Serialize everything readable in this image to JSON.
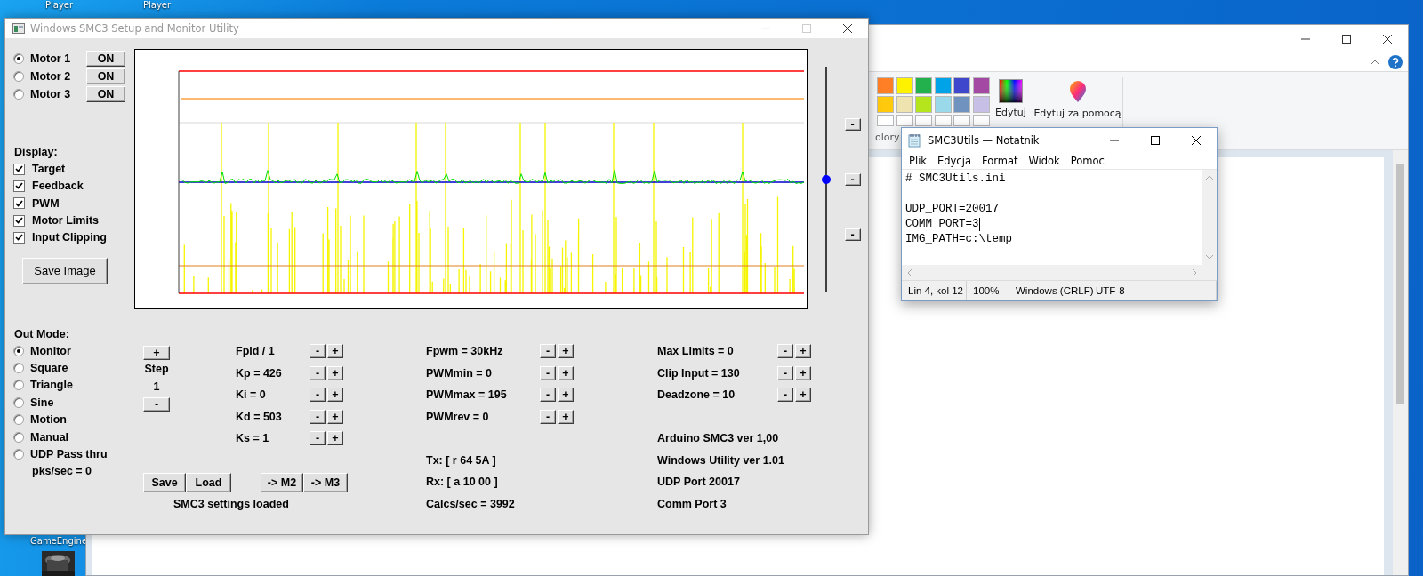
{
  "desktop": {
    "top_icons": [
      {
        "label": "Player"
      },
      {
        "label": "Player"
      }
    ],
    "bottom_icons": [
      {
        "label": "GameEngine"
      }
    ]
  },
  "paint": {
    "palette": [
      [
        {
          "color": "#ff7f27"
        },
        {
          "color": "#fff200"
        },
        {
          "color": "#22b14c"
        },
        {
          "color": "#00a2e8"
        },
        {
          "color": "#3f48cc"
        },
        {
          "color": "#a349a4"
        }
      ],
      [
        {
          "color": "#ffc90e"
        },
        {
          "color": "#efe4b0"
        },
        {
          "color": "#b5e61d"
        },
        {
          "color": "#99d9ea"
        },
        {
          "color": "#7092be"
        },
        {
          "color": "#c8bfe7"
        }
      ],
      [
        {
          "color": "#ffffff"
        },
        {
          "color": "#ffffff"
        },
        {
          "color": "#ffffff"
        },
        {
          "color": "#ffffff"
        },
        {
          "color": "#ffffff"
        },
        {
          "color": "#ffffff"
        }
      ]
    ],
    "edit_colors": "Edytuj",
    "paint3d": "Edytuj za pomocą",
    "colors_label": "olory"
  },
  "smc3": {
    "title": "Windows SMC3 Setup and Monitor Utility",
    "motors": [
      {
        "label": "Motor 1",
        "selected": true,
        "toggle": "ON"
      },
      {
        "label": "Motor 2",
        "selected": false,
        "toggle": "ON"
      },
      {
        "label": "Motor 3",
        "selected": false,
        "toggle": "ON"
      }
    ],
    "display": {
      "label": "Display:",
      "options": [
        {
          "label": "Target",
          "checked": true
        },
        {
          "label": "Feedback",
          "checked": true
        },
        {
          "label": "PWM",
          "checked": true
        },
        {
          "label": "Motor Limits",
          "checked": true
        },
        {
          "label": "Input Clipping",
          "checked": true
        }
      ]
    },
    "save_image": "Save Image",
    "zoom_slider": {
      "level": 0.5,
      "buttons": [
        "-",
        "-",
        "-"
      ]
    },
    "out_mode": {
      "label": "Out Mode:",
      "options": [
        {
          "label": "Monitor",
          "selected": true
        },
        {
          "label": "Square",
          "selected": false
        },
        {
          "label": "Triangle",
          "selected": false
        },
        {
          "label": "Sine",
          "selected": false
        },
        {
          "label": "Motion",
          "selected": false
        },
        {
          "label": "Manual",
          "selected": false
        },
        {
          "label": "UDP Pass thru",
          "selected": false
        }
      ],
      "packets": "pks/sec = 0"
    },
    "step": {
      "increase": "+",
      "label": "Step",
      "value": "1",
      "decrease": "-"
    },
    "pid": [
      {
        "label": "Fpid / 1",
        "minus": "-",
        "plus": "+"
      },
      {
        "label": "Kp = 426",
        "minus": "-",
        "plus": "+"
      },
      {
        "label": "Ki = 0",
        "minus": "-",
        "plus": "+"
      },
      {
        "label": "Kd = 503",
        "minus": "-",
        "plus": "+"
      },
      {
        "label": "Ks = 1",
        "minus": "-",
        "plus": "+"
      }
    ],
    "pwm": [
      {
        "label": "Fpwm = 30kHz",
        "minus": "-",
        "plus": "+"
      },
      {
        "label": "PWMmin = 0",
        "minus": "-",
        "plus": "+"
      },
      {
        "label": "PWMmax = 195",
        "minus": "-",
        "plus": "+"
      },
      {
        "label": "PWMrev = 0",
        "minus": "-",
        "plus": "+"
      }
    ],
    "limits": [
      {
        "label": "Max Limits = 0",
        "minus": "-",
        "plus": "+"
      },
      {
        "label": "Clip Input = 130",
        "minus": "-",
        "plus": "+"
      },
      {
        "label": "Deadzone = 10",
        "minus": "-",
        "plus": "+"
      }
    ],
    "file_buttons": [
      "Save",
      "Load"
    ],
    "copy_buttons": [
      "-> M2",
      "-> M3"
    ],
    "message": "SMC3 settings loaded",
    "comms": [
      "Tx: [ r 64 5A ]",
      "Rx: [ a 10 00 ]",
      "Calcs/sec = 3992"
    ],
    "info": [
      "Arduino SMC3 ver 1,00",
      "Windows Utility ver 1.01",
      "UDP Port 20017",
      "Comm Port 3"
    ]
  },
  "notepad": {
    "title": "SMC3Utils — Notatnik",
    "menu": [
      "Plik",
      "Edycja",
      "Format",
      "Widok",
      "Pomoc"
    ],
    "lines": [
      {
        "kind": "text",
        "text": "# SMC3Utils.ini",
        "caret": false
      },
      {
        "kind": "blank"
      },
      {
        "kind": "text",
        "text": "UDP_PORT=20017",
        "caret": false
      },
      {
        "kind": "text",
        "text": "COMM_PORT=3",
        "caret": true
      },
      {
        "kind": "text",
        "text": "IMG_PATH=c:\\temp",
        "caret": false
      }
    ],
    "status": [
      "Lin 4, kol 12",
      "100%",
      "Windows (CRLF)",
      "UTF-8"
    ]
  }
}
